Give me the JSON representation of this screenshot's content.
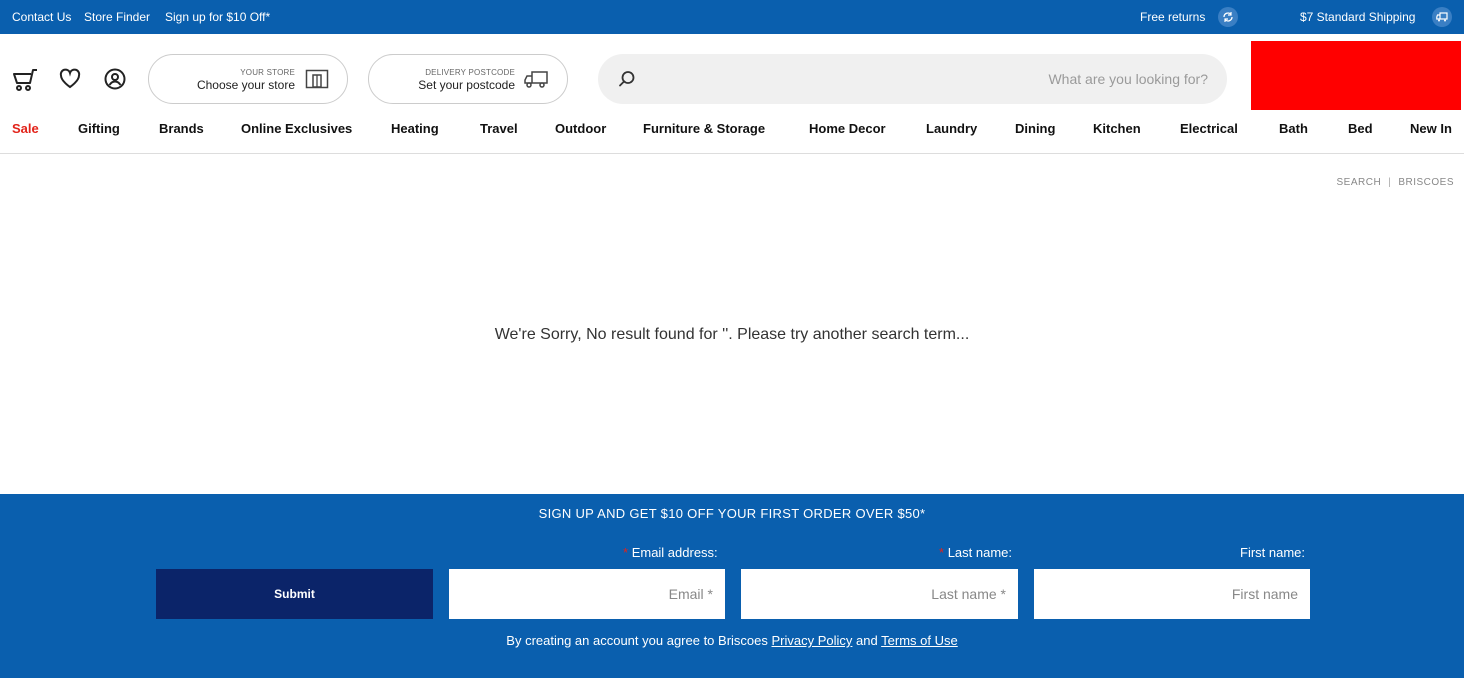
{
  "topbar": {
    "shipping": "$7 Standard Shipping",
    "returns": "Free returns",
    "contact": "Contact Us",
    "store_finder": "Store Finder",
    "signup": "Sign up for $10 Off*",
    "shipping_icon": "truck-icon",
    "returns_icon": "refresh-icon"
  },
  "search": {
    "placeholder": "What are you looking for?"
  },
  "delivery": {
    "small": "DELIVERY POSTCODE",
    "main": "Set your postcode"
  },
  "store": {
    "small": "YOUR STORE",
    "main": "Choose your store"
  },
  "nav": {
    "items": [
      "New In",
      "Bed",
      "Bath",
      "Electrical",
      "Kitchen",
      "Dining",
      "Laundry",
      "Home Decor",
      "Furniture & Storage",
      "Outdoor",
      "Travel",
      "Heating",
      "Online Exclusives",
      "Brands",
      "Gifting",
      "Sale"
    ]
  },
  "breadcrumb": {
    "home": "BRISCOES",
    "current": "SEARCH"
  },
  "message": "We're Sorry, No result found for ''. Please try another search term...",
  "signup": {
    "heading": "SIGN UP AND GET $10 OFF YOUR FIRST ORDER OVER $50*",
    "first_label": "First name:",
    "first_placeholder": "First name",
    "last_label": "Last name:",
    "last_placeholder": "Last name *",
    "email_label": "Email address:",
    "email_placeholder": "Email *",
    "required_mark": "*",
    "submit": "Submit",
    "legal_prefix": "By creating an account you agree to Briscoes",
    "privacy": "Privacy Policy",
    "and": "and",
    "terms": "Terms of Use"
  },
  "colors": {
    "brand_blue": "#0a5fae",
    "button_navy": "#0b2469",
    "sale_red": "#e2231a",
    "logo_red": "#ff0000"
  }
}
